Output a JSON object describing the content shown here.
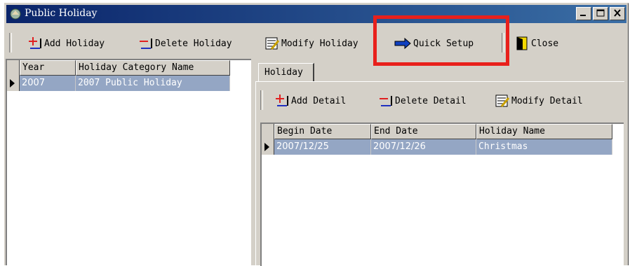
{
  "window": {
    "title": "Public Holiday",
    "title_icon": "public-holiday-icon"
  },
  "toolbar": {
    "add_holiday": "Add Holiday",
    "delete_holiday": "Delete Holiday",
    "modify_holiday": "Modify Holiday",
    "quick_setup": "Quick Setup",
    "close": "Close"
  },
  "holiday_grid": {
    "columns": [
      "Year",
      "Holiday Category Name"
    ],
    "rows": [
      {
        "year": "2007",
        "name": "2007 Public Holiday"
      }
    ]
  },
  "detail": {
    "tab_label": "Holiday",
    "toolbar": {
      "add_detail": "Add Detail",
      "delete_detail": "Delete Detail",
      "modify_detail": "Modify Detail"
    },
    "columns": [
      "Begin Date",
      "End Date",
      "Holiday Name"
    ],
    "rows": [
      {
        "begin": "2007/12/25",
        "end": "2007/12/26",
        "name": "Christmas"
      }
    ]
  },
  "colors": {
    "selection": "#94a6c4",
    "highlight_box": "#e8201c",
    "titlebar": "#0a246a"
  }
}
